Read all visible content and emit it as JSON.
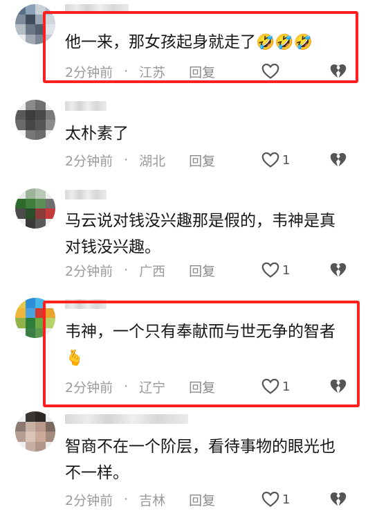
{
  "comments": [
    {
      "text": "他一来，那女孩起身就走了",
      "emoji": "🤣🤣🤣",
      "time": "2分钟前",
      "sep": "·",
      "location": "江苏",
      "reply": "回复",
      "likes": ""
    },
    {
      "text": "太朴素了",
      "emoji": "",
      "time": "2分钟前",
      "sep": "·",
      "location": "湖北",
      "reply": "回复",
      "likes": "1"
    },
    {
      "text": "马云说对钱没兴趣那是假的，韦神是真对钱没兴趣。",
      "emoji": "",
      "time": "2分钟前",
      "sep": "·",
      "location": "广西",
      "reply": "回复",
      "likes": "1"
    },
    {
      "text": "韦神，一个只有奉献而与世无争的智者",
      "emoji": "🫰",
      "time": "2分钟前",
      "sep": "·",
      "location": "辽宁",
      "reply": "回复",
      "likes": "1"
    },
    {
      "text": "智商不在一个阶层，看待事物的眼光也不一样。",
      "emoji": "",
      "time": "2分钟前",
      "sep": "·",
      "location": "吉林",
      "reply": "回复",
      "likes": "1"
    }
  ],
  "icons": {
    "like": "heart-outline-icon",
    "dislike": "broken-heart-icon"
  },
  "colors": {
    "highlight": "#ff1f1f",
    "meta": "#9a9a9a",
    "text": "#161616"
  }
}
